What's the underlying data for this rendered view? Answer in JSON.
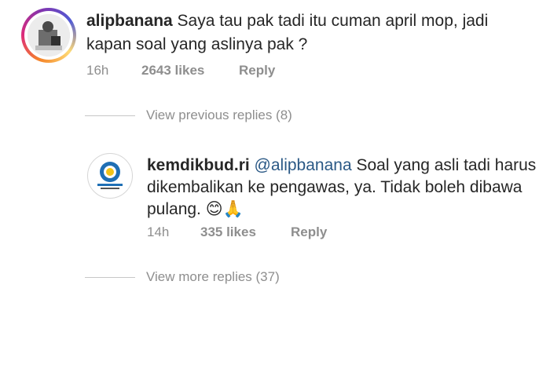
{
  "comments": [
    {
      "username": "alipbanana",
      "text_line1": "Saya tau pak tadi itu cuman april mop, jadi",
      "text_line2": "kapan soal yang aslinya pak ?",
      "time": "16h",
      "likes": "2643 likes",
      "reply": "Reply"
    },
    {
      "username": "kemdikbud.ri",
      "mention": "@alipbanana",
      "text_line1": "Soal yang asli tadi harus",
      "text_line2": "dikembalikan ke pengawas, ya. Tidak boleh dibawa",
      "text_line3": "pulang.",
      "emoji": "😊🙏",
      "time": "14h",
      "likes": "335 likes",
      "reply": "Reply"
    }
  ],
  "view_previous": "View previous replies (8)",
  "view_more": "View more replies (37)",
  "colors": {
    "text": "#262626",
    "muted": "#8e8e8e",
    "mention": "#2a5885"
  }
}
